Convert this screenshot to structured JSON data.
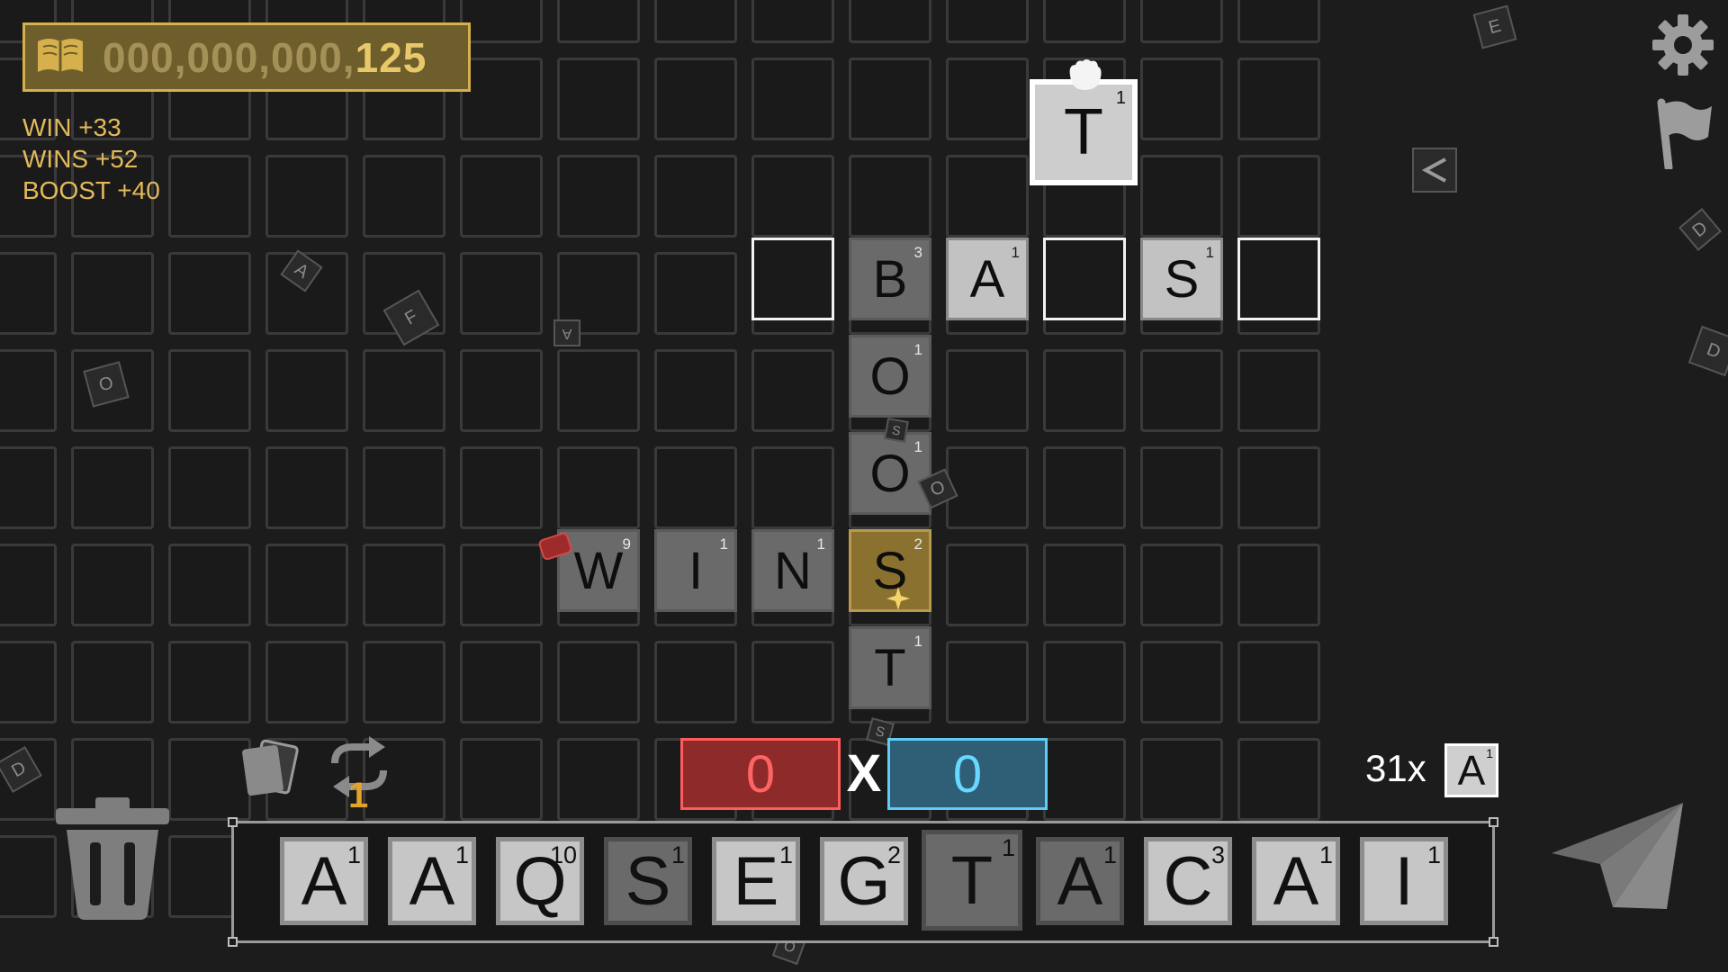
{
  "score": {
    "dim": "000,000,000,",
    "bright": "125"
  },
  "bonuses": [
    "WIN +33",
    "WINS +52",
    "BOOST +40"
  ],
  "board": {
    "held_tile": {
      "letter": "T",
      "points": "1"
    },
    "tiles": [
      {
        "letter": "B",
        "points": "3",
        "style": "dark"
      },
      {
        "letter": "A",
        "points": "1",
        "style": "light"
      },
      {
        "letter": "S",
        "points": "1",
        "style": "light"
      },
      {
        "letter": "O",
        "points": "1",
        "style": "dark"
      },
      {
        "letter": "O",
        "points": "1",
        "style": "dark"
      },
      {
        "letter": "W",
        "points": "9",
        "style": "dark"
      },
      {
        "letter": "I",
        "points": "1",
        "style": "dark"
      },
      {
        "letter": "N",
        "points": "1",
        "style": "dark"
      },
      {
        "letter": "S",
        "points": "2",
        "style": "gold"
      },
      {
        "letter": "T",
        "points": "1",
        "style": "dark"
      }
    ],
    "debris_letters": [
      "A",
      "F",
      "A",
      "O",
      "O",
      "S",
      "S",
      "D",
      "O",
      "E",
      "D",
      "D"
    ]
  },
  "versus": {
    "red": "0",
    "x": "X",
    "blue": "0"
  },
  "hint": {
    "count": "31x",
    "letter": "A",
    "points": "1"
  },
  "swap_count": "1",
  "rack": [
    {
      "letter": "A",
      "points": "1",
      "style": "light"
    },
    {
      "letter": "A",
      "points": "1",
      "style": "light"
    },
    {
      "letter": "Q",
      "points": "10",
      "style": "light"
    },
    {
      "letter": "S",
      "points": "1",
      "style": "dark"
    },
    {
      "letter": "E",
      "points": "1",
      "style": "light"
    },
    {
      "letter": "G",
      "points": "2",
      "style": "light"
    },
    {
      "letter": "T",
      "points": "1",
      "style": "dark"
    },
    {
      "letter": "A",
      "points": "1",
      "style": "dark"
    },
    {
      "letter": "C",
      "points": "3",
      "style": "light"
    },
    {
      "letter": "A",
      "points": "1",
      "style": "light"
    },
    {
      "letter": "I",
      "points": "1",
      "style": "light"
    }
  ],
  "colors": {
    "gold_accent": "#d5b04c",
    "red_team": "#ff5c5c",
    "blue_team": "#5fcdf5",
    "swap_count": "#e2a329"
  },
  "icons": [
    "book-icon",
    "settings-gear-icon",
    "flag-icon",
    "trash-icon",
    "cards-icon",
    "swap-arrows-icon",
    "send-paper-plane-icon",
    "grab-hand-icon",
    "share-icon",
    "dynamite-icon"
  ]
}
